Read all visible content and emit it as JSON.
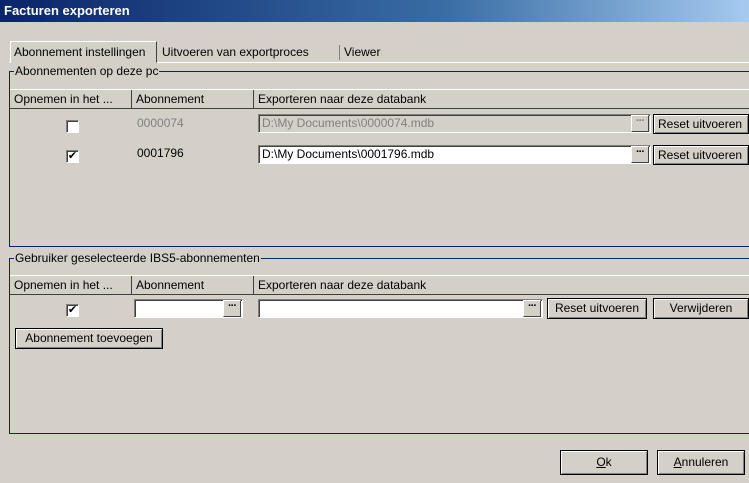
{
  "window": {
    "title": "Facturen exporteren"
  },
  "tabs": [
    {
      "label": "Abonnement instellingen"
    },
    {
      "label": "Uitvoeren van exportproces"
    },
    {
      "label": "Viewer"
    }
  ],
  "group1": {
    "title": "Abonnementen op deze pc",
    "columns": [
      "Opnemen in het ...",
      "Abonnement",
      "Exporteren naar deze databank"
    ],
    "rows": [
      {
        "checked": false,
        "enabled": false,
        "abonnement": "0000074",
        "path": "D:\\My Documents\\0000074.mdb",
        "reset_label": "Reset uitvoeren"
      },
      {
        "checked": true,
        "enabled": true,
        "abonnement": "0001796",
        "path": "D:\\My Documents\\0001796.mdb",
        "reset_label": "Reset uitvoeren"
      }
    ]
  },
  "group2": {
    "title": "Gebruiker geselecteerde IBS5-abonnementen",
    "columns": [
      "Opnemen in het ...",
      "Abonnement",
      "Exporteren naar deze databank"
    ],
    "row": {
      "checked": true,
      "abonnement": "",
      "path": "",
      "reset_label": "Reset uitvoeren",
      "delete_label": "Verwijderen"
    },
    "add_label": "Abonnement toevoegen"
  },
  "footer": {
    "ok_label": "Ok",
    "ok_mnemonic": "O",
    "ok_rest": "k",
    "cancel_label": "Annuleren",
    "cancel_mnemonic": "A",
    "cancel_rest": "nnuleren"
  },
  "icons": {
    "ellipsis": "···",
    "check": "✔"
  }
}
